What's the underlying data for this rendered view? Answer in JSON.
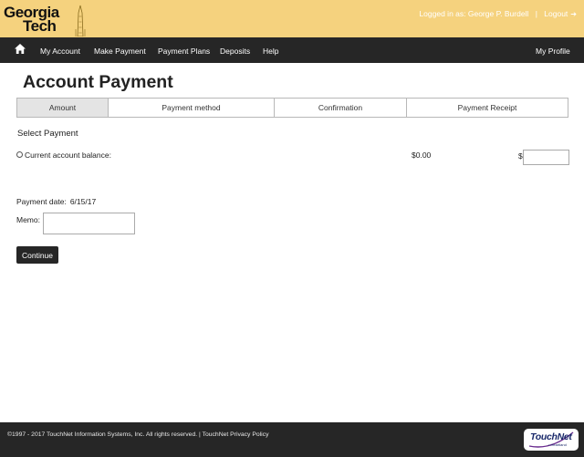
{
  "header": {
    "logo": {
      "line1": "Georgia",
      "line2": "Tech"
    },
    "logged_in_text": "Logged in as: George P. Burdell",
    "separator": "|",
    "logout_label": "Logout",
    "logout_icon": "logout-icon",
    "background_color": "#f5d27e"
  },
  "nav": {
    "home_icon": "home-icon",
    "items": [
      "My Account",
      "Make Payment",
      "Payment Plans",
      "Deposits",
      "Help"
    ],
    "profile_label": "My Profile",
    "background_color": "#262626"
  },
  "page": {
    "title": "Account Payment"
  },
  "steps": [
    {
      "label": "Amount",
      "active": true
    },
    {
      "label": "Payment method",
      "active": false
    },
    {
      "label": "Confirmation",
      "active": false
    },
    {
      "label": "Payment Receipt",
      "active": false
    }
  ],
  "form": {
    "section_label": "Select Payment",
    "balance_label": "Current account balance:",
    "balance_amount": "$0.00",
    "currency_symbol": "$",
    "amount_value": "",
    "payment_date_label": "Payment date:",
    "payment_date_value": "6/15/17",
    "memo_label": "Memo:",
    "memo_value": "",
    "continue_label": "Continue"
  },
  "footer": {
    "copyright": "©1997 - 2017  TouchNet Information Systems, Inc. All rights reserved. |",
    "privacy_link": "TouchNet Privacy Policy",
    "logo_text": "TouchNet",
    "logo_sub": "• Heartland"
  }
}
